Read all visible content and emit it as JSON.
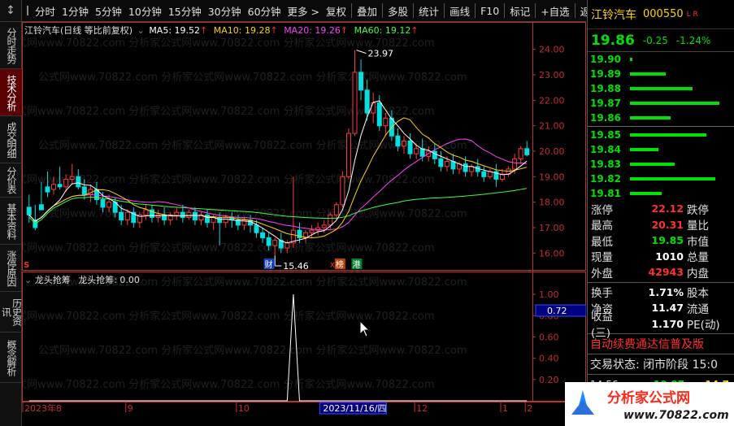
{
  "left_tabs": {
    "corner": "↕",
    "items": [
      {
        "label": "分时走势",
        "active": false
      },
      {
        "label": "技术分析",
        "active": true
      },
      {
        "label": "成交明细",
        "active": false
      },
      {
        "label": "分价表",
        "active": false
      },
      {
        "label": "基本资料",
        "active": false
      },
      {
        "label": "涨停原因",
        "active": false
      },
      {
        "label": "历史资讯",
        "active": false
      },
      {
        "label": "概念解析",
        "active": false
      }
    ]
  },
  "toolbar": {
    "periods": [
      "分时",
      "1分钟",
      "5分钟",
      "10分钟",
      "15分钟",
      "30分钟",
      "60分钟",
      "更多 >"
    ],
    "actions": [
      "复权",
      "叠加",
      "多股",
      "统计",
      "画线",
      "F10",
      "标记",
      "+自选",
      "返回"
    ]
  },
  "main_legend": {
    "title": "江铃汽车(日线 等比前复权)",
    "ma5": "MA5: 19.52",
    "ma10": "MA10: 19.28",
    "ma20": "MA20: 19.26",
    "ma60": "MA60: 19.12",
    "arrow": "↑"
  },
  "indicator_legend": {
    "title": "龙头抢筹",
    "value": "龙头抢筹: 0.00"
  },
  "annotations": {
    "high_label": "23.97",
    "low_label": "15.46",
    "marker_s": "S",
    "marker_cai": "财",
    "marker_bang": "榜",
    "marker_gang": "港",
    "marker_x": "X"
  },
  "chart_data": [
    {
      "type": "candlestick",
      "ylim": [
        15.5,
        24.5
      ],
      "y_ticks": [
        "24.00",
        "23.00",
        "22.00",
        "21.00",
        "20.00",
        "19.00",
        "18.00",
        "17.00",
        "16.00"
      ],
      "candles": [
        [
          17.8,
          18.3,
          17.5,
          17.2
        ],
        [
          17.3,
          17.9,
          17.0,
          16.9
        ],
        [
          17.9,
          18.8,
          17.7,
          17.8
        ],
        [
          18.6,
          19.2,
          18.4,
          18.2
        ],
        [
          18.5,
          19.0,
          18.7,
          18.3
        ],
        [
          18.7,
          19.4,
          18.6,
          18.5
        ],
        [
          18.6,
          19.1,
          18.9,
          18.4
        ],
        [
          18.9,
          19.5,
          19.0,
          18.7
        ],
        [
          19.0,
          19.3,
          18.6,
          18.5
        ],
        [
          18.6,
          18.9,
          18.3,
          18.1
        ],
        [
          18.3,
          18.7,
          18.5,
          18.0
        ],
        [
          18.5,
          18.8,
          18.1,
          17.9
        ],
        [
          18.1,
          18.4,
          17.8,
          17.6
        ],
        [
          17.8,
          18.3,
          18.0,
          17.6
        ],
        [
          18.0,
          18.2,
          17.6,
          17.4
        ],
        [
          17.6,
          17.9,
          17.3,
          17.1
        ],
        [
          17.3,
          17.7,
          17.6,
          17.1
        ],
        [
          17.6,
          17.8,
          17.2,
          17.0
        ],
        [
          17.2,
          17.6,
          17.5,
          17.0
        ],
        [
          17.5,
          17.9,
          17.7,
          17.3
        ],
        [
          17.7,
          17.9,
          17.4,
          17.2
        ],
        [
          17.4,
          17.7,
          17.5,
          17.2
        ],
        [
          17.5,
          17.8,
          17.3,
          17.1
        ],
        [
          17.3,
          17.6,
          17.5,
          17.1
        ],
        [
          17.5,
          17.8,
          17.6,
          17.3
        ],
        [
          17.6,
          17.9,
          17.4,
          17.2
        ],
        [
          17.4,
          17.7,
          17.6,
          17.3
        ],
        [
          17.6,
          17.8,
          17.3,
          17.1
        ],
        [
          17.3,
          17.6,
          17.5,
          17.1
        ],
        [
          17.5,
          17.7,
          17.2,
          17.0
        ],
        [
          17.2,
          17.5,
          17.4,
          16.9
        ],
        [
          17.4,
          17.6,
          17.2,
          16.3
        ],
        [
          17.2,
          17.5,
          17.4,
          17.0
        ],
        [
          17.4,
          17.6,
          17.3,
          17.0
        ],
        [
          17.3,
          17.5,
          17.1,
          16.9
        ],
        [
          17.1,
          17.4,
          17.3,
          16.9
        ],
        [
          17.3,
          17.5,
          17.1,
          16.8
        ],
        [
          17.1,
          17.3,
          16.8,
          16.6
        ],
        [
          16.8,
          17.0,
          16.6,
          16.4
        ],
        [
          16.6,
          16.8,
          16.3,
          16.1
        ],
        [
          16.3,
          16.6,
          16.5,
          15.9
        ],
        [
          16.5,
          16.8,
          16.2,
          16.0
        ],
        [
          16.2,
          16.5,
          16.4,
          16.0
        ],
        [
          16.4,
          19.0,
          16.9,
          16.2
        ],
        [
          16.9,
          17.2,
          16.6,
          16.4
        ],
        [
          16.6,
          16.9,
          16.8,
          16.4
        ],
        [
          16.8,
          17.1,
          16.9,
          16.6
        ],
        [
          16.9,
          17.2,
          17.0,
          16.7
        ],
        [
          17.0,
          17.3,
          17.1,
          16.8
        ],
        [
          17.1,
          17.6,
          17.5,
          16.9
        ],
        [
          17.5,
          18.0,
          17.9,
          17.3
        ],
        [
          17.9,
          19.2,
          19.0,
          17.8
        ],
        [
          19.0,
          20.9,
          20.7,
          18.9
        ],
        [
          20.7,
          23.97,
          23.1,
          20.6
        ],
        [
          23.1,
          23.6,
          22.4,
          22.0
        ],
        [
          22.4,
          22.8,
          21.5,
          21.2
        ],
        [
          21.5,
          22.3,
          21.9,
          21.1
        ],
        [
          21.9,
          22.2,
          21.0,
          20.8
        ],
        [
          21.0,
          21.5,
          21.3,
          20.6
        ],
        [
          21.3,
          21.6,
          20.6,
          20.4
        ],
        [
          20.6,
          20.9,
          20.2,
          20.0
        ],
        [
          20.2,
          20.6,
          20.4,
          19.9
        ],
        [
          20.4,
          20.7,
          19.9,
          19.7
        ],
        [
          19.9,
          20.3,
          20.1,
          19.7
        ],
        [
          20.1,
          20.5,
          19.8,
          19.6
        ],
        [
          19.8,
          20.2,
          20.0,
          19.6
        ],
        [
          20.0,
          20.3,
          19.7,
          19.5
        ],
        [
          19.7,
          20.0,
          19.4,
          19.2
        ],
        [
          19.4,
          19.8,
          19.6,
          19.2
        ],
        [
          19.6,
          19.9,
          19.3,
          19.1
        ],
        [
          19.3,
          19.6,
          19.5,
          19.1
        ],
        [
          19.5,
          19.8,
          19.2,
          19.0
        ],
        [
          19.2,
          19.5,
          19.4,
          19.0
        ],
        [
          19.4,
          19.7,
          19.2,
          19.0
        ],
        [
          19.2,
          19.4,
          19.0,
          18.8
        ],
        [
          19.0,
          19.3,
          19.2,
          18.9
        ],
        [
          19.2,
          19.5,
          18.9,
          18.6
        ],
        [
          18.9,
          19.3,
          19.1,
          18.8
        ],
        [
          19.1,
          19.4,
          19.3,
          19.0
        ],
        [
          19.3,
          19.9,
          19.7,
          19.1
        ],
        [
          19.7,
          20.2,
          20.1,
          19.5
        ],
        [
          20.1,
          20.4,
          19.86,
          19.8
        ]
      ]
    },
    {
      "type": "line",
      "ylim": [
        0,
        1.1
      ],
      "y_ticks": [
        "1.00",
        "0.80",
        "0.60",
        "0.40",
        "0.20"
      ],
      "values": [
        0,
        0,
        0,
        0,
        0,
        0,
        0,
        0,
        0,
        0,
        0,
        0,
        0,
        0,
        0,
        0,
        0,
        0,
        0,
        0,
        0,
        0,
        0,
        0,
        0,
        0,
        0,
        0,
        0,
        0,
        0,
        0,
        0,
        0,
        0,
        0,
        0,
        0,
        0,
        0,
        0,
        0,
        0,
        1,
        0,
        0,
        0,
        0,
        0,
        0,
        0,
        0,
        0,
        0,
        0,
        0,
        0,
        0,
        0,
        0,
        0,
        0,
        0,
        0,
        0,
        0,
        0,
        0,
        0,
        0,
        0,
        0,
        0,
        0,
        0,
        0,
        0,
        0,
        0,
        0,
        0,
        0
      ],
      "cursor_value": "0.72"
    }
  ],
  "x_axis": {
    "labels": [
      "2023年8",
      "9",
      "10",
      "11",
      "12",
      "1",
      "2"
    ],
    "highlight": "2023/11/16/四"
  },
  "right_panel": {
    "name": "江铃汽车",
    "code": "000550",
    "tag": "L R",
    "price": "19.86",
    "change": "-0.25",
    "change_pct": "-1.24%",
    "order_book": [
      {
        "price": "19.90",
        "bar": 0.03
      },
      {
        "price": "19.89",
        "bar": 0.4
      },
      {
        "price": "19.88",
        "bar": 0.7
      },
      {
        "price": "19.87",
        "bar": 1.0
      },
      {
        "price": "19.86",
        "bar": 0.45
      },
      {
        "price": "19.85",
        "bar": 0.85
      },
      {
        "price": "19.84",
        "bar": 0.32
      },
      {
        "price": "19.83",
        "bar": 0.5
      },
      {
        "price": "19.82",
        "bar": 0.95
      },
      {
        "price": "19.81",
        "bar": 0.35
      }
    ],
    "quotes": [
      {
        "l1": "涨停",
        "v": "22.12",
        "color": "#ff3030",
        "l2": "跌停"
      },
      {
        "l1": "最高",
        "v": "20.31",
        "color": "#ff3030",
        "l2": "量比"
      },
      {
        "l1": "最低",
        "v": "19.85",
        "color": "#00e000",
        "l2": "市值"
      },
      {
        "l1": "现量",
        "v": "1010",
        "color": "#ffffff",
        "l2": "总量"
      },
      {
        "l1": "外盘",
        "v": "42943",
        "color": "#ff3030",
        "l2": "内盘"
      }
    ],
    "quotes2": [
      {
        "l1": "换手",
        "v": "1.71%",
        "color": "#ffffff",
        "l2": "股本"
      },
      {
        "l1": "净资",
        "v": "11.47",
        "color": "#ffffff",
        "l2": "流通"
      },
      {
        "l1": "收益(三)",
        "v": "1.170",
        "color": "#ffffff",
        "l2": "PE(动)"
      }
    ],
    "banner": "自动续费通达信普及版",
    "status": "交易状态: 闭市阶段 15:0",
    "tick": {
      "time": "14:56",
      "a": "19.87",
      "b": "14.7"
    }
  },
  "logo": {
    "text1": "分析家公式网",
    "text2": "www.70822.com"
  },
  "colors": {
    "up": "#ff3b3b",
    "down": "#00e0e0",
    "ma5": "#ffffff",
    "ma10": "#ffd400",
    "ma20": "#ff40ff",
    "ma60": "#40ff40",
    "axis": "#c03030"
  }
}
